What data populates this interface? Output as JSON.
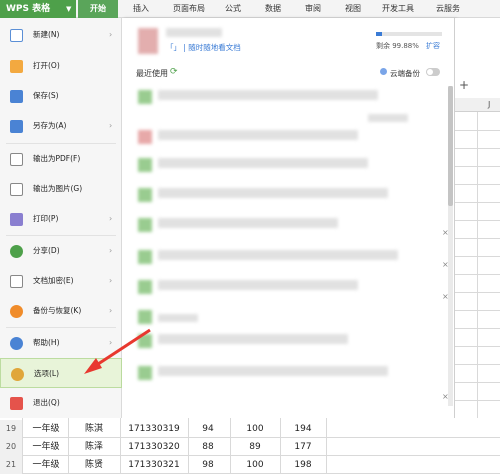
{
  "app": {
    "title": "WPS 表格"
  },
  "tabs": [
    {
      "label": "开始"
    },
    {
      "label": "插入"
    },
    {
      "label": "页面布局"
    },
    {
      "label": "公式"
    },
    {
      "label": "数据"
    },
    {
      "label": "审阅"
    },
    {
      "label": "视图"
    },
    {
      "label": "开发工具"
    },
    {
      "label": "云服务"
    }
  ],
  "menu": {
    "items": [
      {
        "label": "新建(N)",
        "icon": "new-doc-icon"
      },
      {
        "label": "打开(O)",
        "icon": "folder-icon"
      },
      {
        "label": "保存(S)",
        "icon": "save-icon"
      },
      {
        "label": "另存为(A)",
        "icon": "save-as-icon"
      },
      {
        "label": "输出为PDF(F)",
        "icon": "pdf-icon"
      },
      {
        "label": "输出为图片(G)",
        "icon": "image-icon"
      },
      {
        "label": "打印(P)",
        "icon": "print-icon"
      },
      {
        "label": "分享(D)",
        "icon": "share-icon"
      },
      {
        "label": "文档加密(E)",
        "icon": "lock-icon"
      },
      {
        "label": "备份与恢复(K)",
        "icon": "backup-icon"
      },
      {
        "label": "帮助(H)",
        "icon": "help-icon"
      },
      {
        "label": "选项(L)",
        "icon": "gear-icon"
      },
      {
        "label": "退出(Q)",
        "icon": "exit-icon"
      }
    ]
  },
  "panel": {
    "promo_text": "「」 | 随时随地看文档",
    "storage_text": "剩余 99.88%",
    "expand_label": "扩容",
    "recent_label": "最近使用",
    "cloud_backup_label": "云端备份"
  },
  "sheet": {
    "column_letter": "J",
    "rows": [
      {
        "num": "19",
        "grade": "一年级",
        "name": "陈淇",
        "id": "171330319",
        "a": "94",
        "b": "100",
        "c": "194"
      },
      {
        "num": "20",
        "grade": "一年级",
        "name": "陈泽",
        "id": "171330320",
        "a": "88",
        "b": "89",
        "c": "177"
      },
      {
        "num": "21",
        "grade": "一年级",
        "name": "陈贤",
        "id": "171330321",
        "a": "98",
        "b": "100",
        "c": "198"
      }
    ]
  },
  "colors": {
    "accent": "#4ea04a",
    "selected": "#e8f4d9",
    "arrow": "#e8382f"
  }
}
